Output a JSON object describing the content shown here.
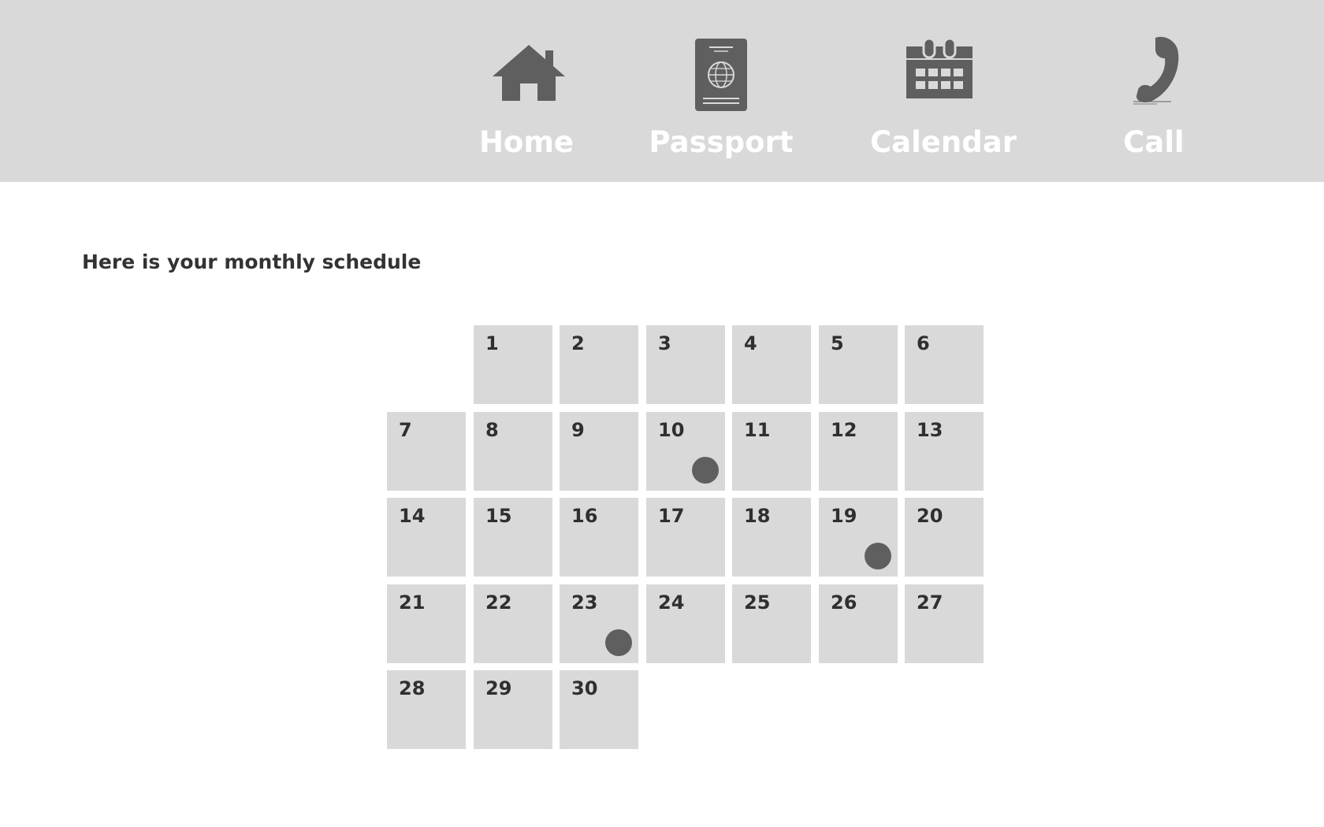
{
  "nav": {
    "items": [
      {
        "label": "Home",
        "icon": "house-icon"
      },
      {
        "label": "Passport",
        "icon": "passport-icon"
      },
      {
        "label": "Calendar",
        "icon": "calendar-icon"
      },
      {
        "label": "Call",
        "icon": "phone-icon"
      }
    ]
  },
  "main": {
    "heading": "Here is your monthly schedule"
  },
  "calendar": {
    "first_weekday_offset": 1,
    "days": [
      "1",
      "2",
      "3",
      "4",
      "5",
      "6",
      "7",
      "8",
      "9",
      "10",
      "11",
      "12",
      "13",
      "14",
      "15",
      "16",
      "17",
      "18",
      "19",
      "20",
      "21",
      "22",
      "23",
      "24",
      "25",
      "26",
      "27",
      "28",
      "29",
      "30"
    ],
    "event_days": [
      "10",
      "19",
      "23"
    ]
  },
  "colors": {
    "bar_background": "#d9d9d9",
    "cell_background": "#d9d9d9",
    "icon_color": "#5f5f5f",
    "nav_label_color": "#ffffff",
    "text_color": "#333333",
    "event_marker": "#5f5f5f"
  }
}
